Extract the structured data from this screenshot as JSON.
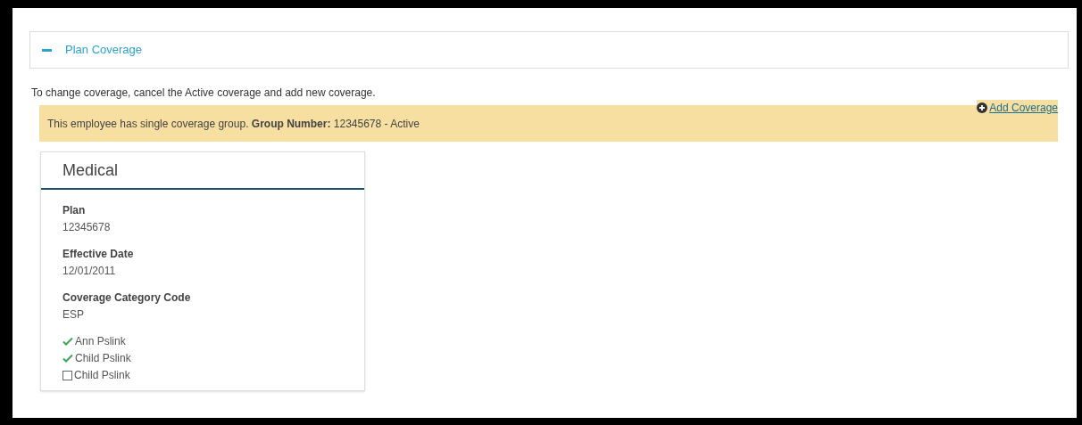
{
  "accordion": {
    "title": "Plan Coverage",
    "expanded": true
  },
  "instruction": "To change coverage, cancel the Active coverage and add new coverage.",
  "add_link": "Add Coverage",
  "alert": "This employee has single coverage group. **Group Number:** 12345678 - Active",
  "card": {
    "title": "Medical",
    "fields": [
      {
        "label": "Plan",
        "value": "12345678"
      },
      {
        "label": "Effective Date",
        "value": "12/01/2011"
      },
      {
        "label": "Coverage Category Code",
        "value": "ESP"
      }
    ],
    "members": [
      {
        "name": "Ann Pslink",
        "checked": true
      },
      {
        "name": "Child Pslink",
        "checked": true
      },
      {
        "name": "Child Pslink",
        "checked": false
      }
    ]
  }
}
